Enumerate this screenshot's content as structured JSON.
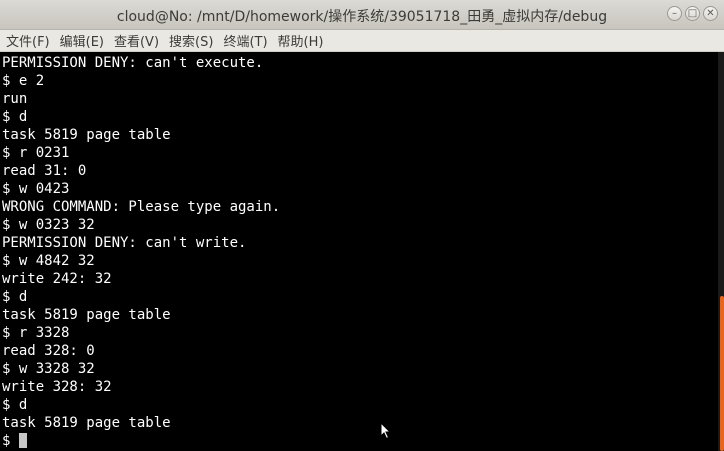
{
  "window": {
    "title": "cloud@No: /mnt/D/homework/操作系统/39051718_田勇_虚拟内存/debug",
    "controls": {
      "minimize": "–",
      "maximize": "□",
      "close": "✕"
    }
  },
  "menubar": {
    "items": [
      {
        "label": "文件(F)"
      },
      {
        "label": "编辑(E)"
      },
      {
        "label": "查看(V)"
      },
      {
        "label": "搜索(S)"
      },
      {
        "label": "终端(T)"
      },
      {
        "label": "帮助(H)"
      }
    ]
  },
  "terminal": {
    "lines": [
      "PERMISSION DENY: can't execute.",
      "$ e 2",
      "run",
      "$ d",
      "task 5819 page table",
      "$ r 0231",
      "read 31: 0",
      "$ w 0423",
      "WRONG COMMAND: Please type again.",
      "$ w 0323 32",
      "PERMISSION DENY: can't write.",
      "$ w 4842 32",
      "write 242: 32",
      "$ d",
      "task 5819 page table",
      "$ r 3328",
      "read 328: 0",
      "$ w 3328 32",
      "write 328: 32",
      "$ d",
      "task 5819 page table"
    ],
    "prompt": "$ ",
    "colors": {
      "background": "#000000",
      "foreground": "#ffffff",
      "scrollbar_thumb": "#e8651e"
    }
  }
}
